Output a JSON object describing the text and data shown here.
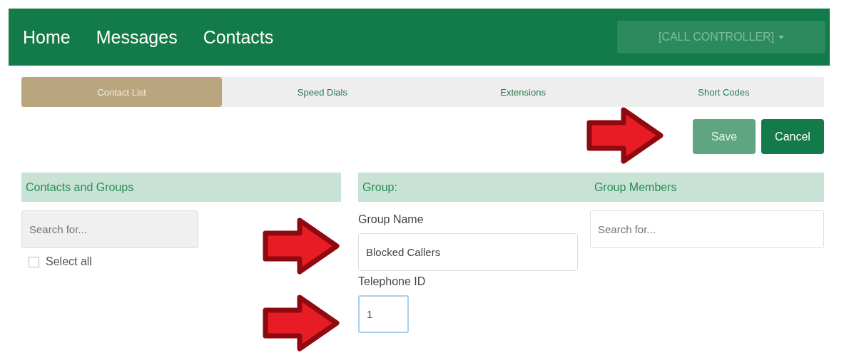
{
  "navbar": {
    "links": [
      {
        "label": "Home"
      },
      {
        "label": "Messages"
      },
      {
        "label": "Contacts"
      }
    ],
    "dropdown": {
      "label": "[CALL CONTROLLER]",
      "disabled": true
    }
  },
  "tabs": [
    {
      "label": "Contact List",
      "selected": true
    },
    {
      "label": "Speed Dials",
      "selected": false
    },
    {
      "label": "Extensions",
      "selected": false
    },
    {
      "label": "Short Codes",
      "selected": false
    }
  ],
  "actions": [
    {
      "label": "Save",
      "disabled": true
    },
    {
      "label": "Cancel",
      "disabled": false
    }
  ],
  "contacts_panel": {
    "heading": "Contacts and Groups",
    "search": {
      "placeholder": "Search for...",
      "disabled": true
    },
    "select_all": {
      "label": "Select all",
      "checked": false
    }
  },
  "group_panel": {
    "heading": "Group:",
    "members_heading": "Group Members",
    "group_name": {
      "label": "Group Name",
      "value": "Blocked Callers",
      "focused": false
    },
    "telephone_id": {
      "label": "Telephone ID",
      "value": "1",
      "focused": true
    },
    "members_search": {
      "placeholder": "Search for..."
    }
  }
}
